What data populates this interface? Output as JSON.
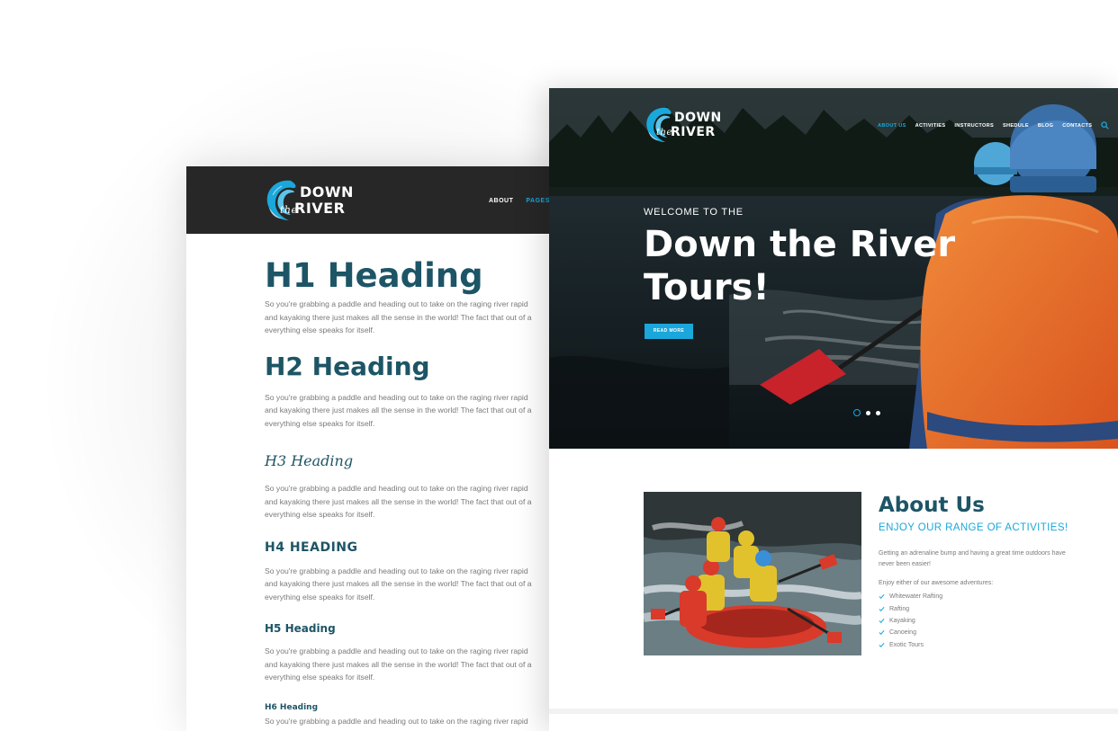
{
  "back_page": {
    "logo": {
      "down": "DOWN",
      "the": "the",
      "river": "RIVER"
    },
    "nav": [
      "ABOUT",
      "PAGES"
    ],
    "headings": {
      "h1": "H1 Heading",
      "h2": "H2 Heading",
      "h3": "H3 Heading",
      "h4": "H4 HEADING",
      "h5": "H5 Heading",
      "h6": "H6 Heading"
    },
    "paragraph_lines": [
      "So you're grabbing a paddle and heading out to take on the raging river rapid",
      "and kayaking there just makes all the sense in the world! The fact that out of a",
      "everything else speaks for itself."
    ]
  },
  "front_page": {
    "logo": {
      "down": "DOWN",
      "the": "the",
      "river": "RIVER"
    },
    "nav": [
      "ABOUT US",
      "ACTIVITIES",
      "INSTRUCTORS",
      "SHEDULE",
      "BLOG",
      "CONTACTS"
    ],
    "nav_active": "ABOUT US",
    "hero": {
      "welcome": "WELCOME TO THE",
      "title_line1": "Down the River",
      "title_line2": "Tours!",
      "button": "READ MORE",
      "slides": 3,
      "active_slide": 1
    },
    "about": {
      "title": "About Us",
      "subtitle": "ENJOY OUR RANGE OF ACTIVITIES!",
      "text": "Getting an adrenaline bump and having a great time outdoors have never been easier!",
      "intro": "Enjoy either of our awesome adventures:",
      "items": [
        "Whitewater Rafting",
        "Rafting",
        "Kayaking",
        "Canoeing",
        "Exotic Tours"
      ]
    }
  },
  "colors": {
    "accent": "#1aa7db",
    "heading": "#1d5566",
    "header_dark": "#272727",
    "body_text": "#7a7a7a"
  },
  "icons": [
    "wave-logo-icon",
    "search-icon",
    "check-icon"
  ]
}
